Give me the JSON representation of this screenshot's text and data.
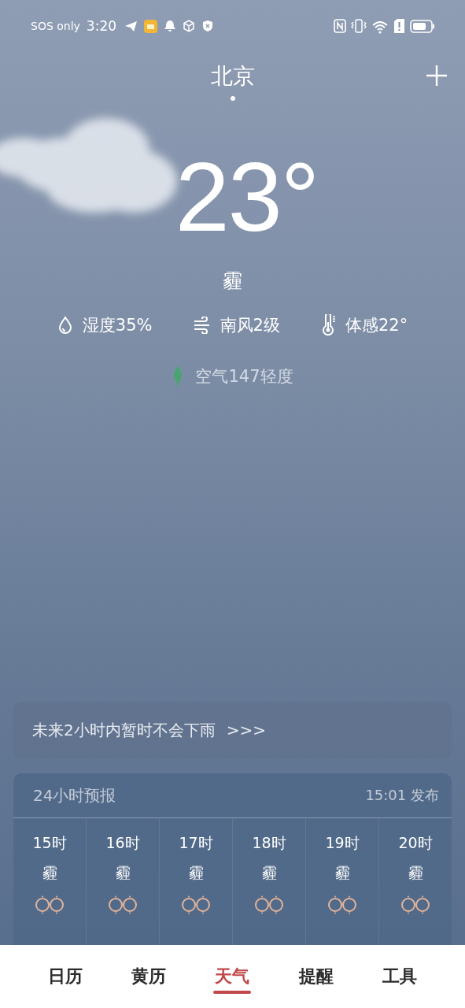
{
  "status_bar": {
    "carrier": "SOS only",
    "time": "3:20"
  },
  "location": {
    "city": "北京"
  },
  "current": {
    "temperature": "23°",
    "condition": "霾",
    "details": [
      {
        "kind": "humidity",
        "text": "湿度35%"
      },
      {
        "kind": "wind",
        "text": "南风2级"
      },
      {
        "kind": "feels_like",
        "text": "体感22°"
      }
    ],
    "air_quality": {
      "text": "空气147轻度"
    }
  },
  "rain_notice": {
    "text": "未来2小时内暂时不会下雨",
    "arrow": ">>>"
  },
  "hourly": {
    "title": "24小时预报",
    "published": "15:01 发布",
    "hours": [
      {
        "time": "15时",
        "condition": "霾"
      },
      {
        "time": "16时",
        "condition": "霾"
      },
      {
        "time": "17时",
        "condition": "霾"
      },
      {
        "time": "18时",
        "condition": "霾"
      },
      {
        "time": "19时",
        "condition": "霾"
      },
      {
        "time": "20时",
        "condition": "霾"
      }
    ]
  },
  "nav": [
    {
      "label": "日历",
      "selected": false
    },
    {
      "label": "黄历",
      "selected": false
    },
    {
      "label": "天气",
      "selected": true
    },
    {
      "label": "提醒",
      "selected": false
    },
    {
      "label": "工具",
      "selected": false
    }
  ]
}
